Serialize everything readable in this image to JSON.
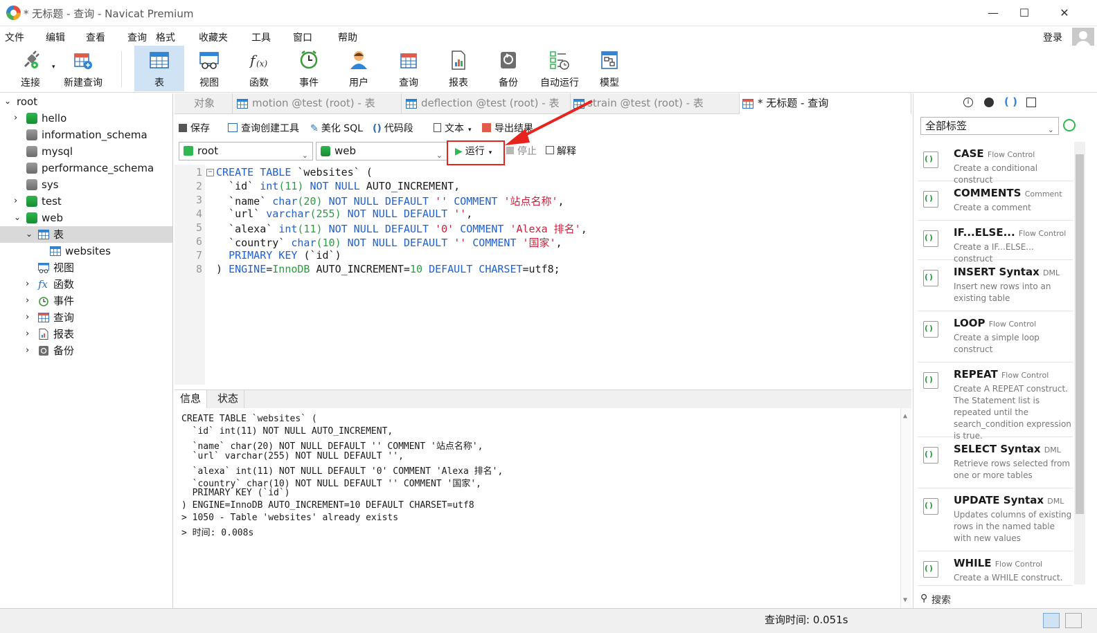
{
  "window": {
    "title": "* 无标题 - 查询 - Navicat Premium",
    "minimize": "—",
    "maximize": "☐",
    "close": "✕"
  },
  "menu": {
    "items": [
      "文件",
      "编辑",
      "查看",
      "查询",
      "格式",
      "收藏夹",
      "工具",
      "窗口",
      "帮助"
    ],
    "login": "登录"
  },
  "toolbar": {
    "items": [
      "连接",
      "新建查询",
      "表",
      "视图",
      "函数",
      "事件",
      "用户",
      "查询",
      "报表",
      "备份",
      "自动运行",
      "模型"
    ]
  },
  "tree": {
    "root": "root",
    "items": [
      "hello",
      "information_schema",
      "mysql",
      "performance_schema",
      "sys",
      "test",
      "web"
    ],
    "web_children": {
      "tables": "表",
      "websites": "websites",
      "views": "视图",
      "functions": "函数",
      "events": "事件",
      "queries": "查询",
      "reports": "报表",
      "backups": "备份"
    }
  },
  "tabs": [
    "对象",
    "motion @test (root) - 表",
    "deflection @test (root) - 表",
    "strain @test (root) - 表",
    "* 无标题 - 查询"
  ],
  "query_toolbar": {
    "save": "保存",
    "builder": "查询创建工具",
    "beautify": "美化 SQL",
    "snippet": "代码段",
    "text": "文本",
    "export": "导出结果"
  },
  "selectors": {
    "connection": "root",
    "database": "web",
    "run": "运行",
    "stop": "停止",
    "explain": "解释"
  },
  "editor": {
    "line_numbers": [
      "1",
      "2",
      "3",
      "4",
      "5",
      "6",
      "7",
      "8"
    ]
  },
  "info": {
    "tabs": [
      "信息",
      "状态"
    ],
    "lines": [
      "CREATE TABLE `websites` (",
      "  `id` int(11) NOT NULL AUTO_INCREMENT,",
      "  `name` char(20) NOT NULL DEFAULT '' COMMENT '站点名称',",
      "  `url` varchar(255) NOT NULL DEFAULT '',",
      "  `alexa` int(11) NOT NULL DEFAULT '0' COMMENT 'Alexa 排名',",
      "  `country` char(10) NOT NULL DEFAULT '' COMMENT '国家',",
      "  PRIMARY KEY (`id`)",
      ") ENGINE=InnoDB AUTO_INCREMENT=10 DEFAULT CHARSET=utf8",
      "> 1050 - Table 'websites' already exists",
      "> 时间: 0.008s"
    ]
  },
  "right_panel": {
    "filter": "全部标签",
    "search": "搜索",
    "snippets": [
      {
        "title": "CASE",
        "tag": "Flow Control",
        "desc": "Create a conditional construct"
      },
      {
        "title": "COMMENTS",
        "tag": "Comment",
        "desc": "Create a comment"
      },
      {
        "title": "IF...ELSE...",
        "tag": "Flow Control",
        "desc": "Create a IF...ELSE... construct"
      },
      {
        "title": "INSERT Syntax",
        "tag": "DML",
        "desc": "Insert new rows into an existing table"
      },
      {
        "title": "LOOP",
        "tag": "Flow Control",
        "desc": "Create a simple loop construct"
      },
      {
        "title": "REPEAT",
        "tag": "Flow Control",
        "desc": "Create A REPEAT construct. The Statement list is repeated until the search_condition expression is true."
      },
      {
        "title": "SELECT Syntax",
        "tag": "DML",
        "desc": "Retrieve rows selected from one or more tables"
      },
      {
        "title": "UPDATE Syntax",
        "tag": "DML",
        "desc": "Updates columns of existing rows in the named table with new values"
      },
      {
        "title": "WHILE",
        "tag": "Flow Control",
        "desc": "Create a WHILE construct."
      }
    ]
  },
  "status": {
    "query_time": "查询时间: 0.051s"
  },
  "colors": {
    "keyword": "#2060d0",
    "number": "#2a9d3f",
    "string": "#d01f3a",
    "highlight": "#e8231d",
    "accent": "#cfe3f5"
  }
}
